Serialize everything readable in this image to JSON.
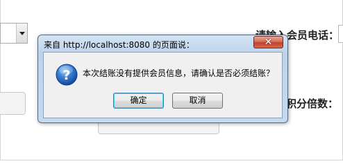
{
  "background": {
    "phone_label": "请输入会员电话：",
    "multiplier_label": "积分倍数："
  },
  "dialog": {
    "title": "来自 http://localhost:8080 的页面说：",
    "message": "本次结账没有提供会员信息，请确认是否必须结账？",
    "close_symbol": "✕",
    "icon": "question-icon",
    "ok_label": "确定",
    "cancel_label": "取消"
  }
}
